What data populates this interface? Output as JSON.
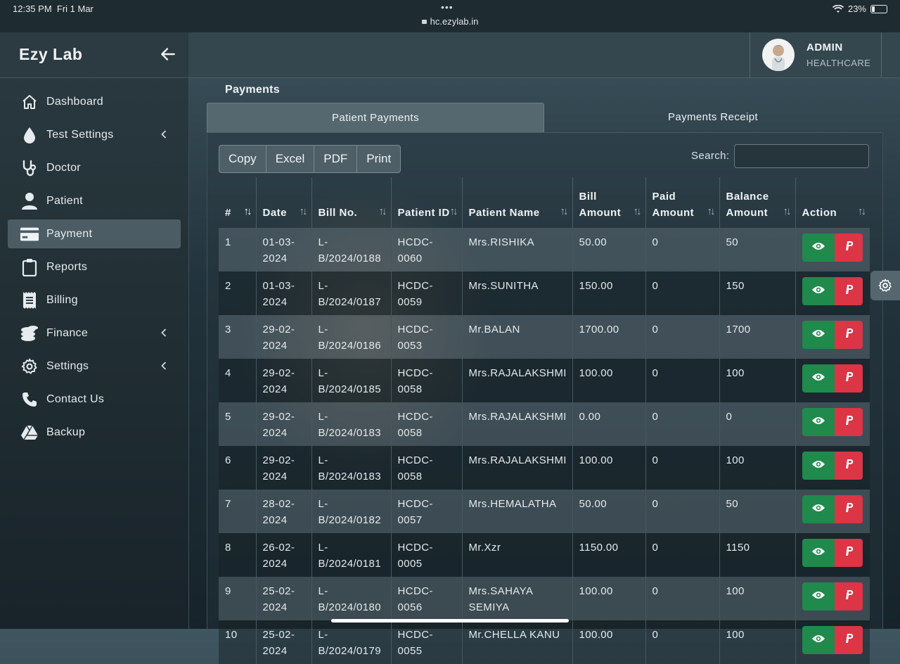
{
  "status_bar": {
    "time": "12:35 PM",
    "date": "Fri 1 Mar",
    "dots": "•••",
    "url": "hc.ezylab.in",
    "battery": "23%"
  },
  "sidebar": {
    "brand": "Ezy Lab",
    "items": [
      {
        "label": "Dashboard",
        "icon": "home-icon",
        "chevron": false,
        "active": false
      },
      {
        "label": "Test Settings",
        "icon": "drop-icon",
        "chevron": true,
        "active": false
      },
      {
        "label": "Doctor",
        "icon": "stethoscope-icon",
        "chevron": false,
        "active": false
      },
      {
        "label": "Patient",
        "icon": "user-icon",
        "chevron": false,
        "active": false
      },
      {
        "label": "Payment",
        "icon": "credit-card-icon",
        "chevron": false,
        "active": true
      },
      {
        "label": "Reports",
        "icon": "clipboard-icon",
        "chevron": false,
        "active": false
      },
      {
        "label": "Billing",
        "icon": "receipt-icon",
        "chevron": false,
        "active": false
      },
      {
        "label": "Finance",
        "icon": "coins-icon",
        "chevron": true,
        "active": false
      },
      {
        "label": "Settings",
        "icon": "gear-icon",
        "chevron": true,
        "active": false
      },
      {
        "label": "Contact Us",
        "icon": "phone-icon",
        "chevron": false,
        "active": false
      },
      {
        "label": "Backup",
        "icon": "drive-icon",
        "chevron": false,
        "active": false
      }
    ]
  },
  "header": {
    "user_name": "ADMIN",
    "user_org": "HEALTHCARE"
  },
  "page": {
    "title": "Payments",
    "tabs": [
      {
        "label": "Patient Payments",
        "active": true
      },
      {
        "label": "Payments Receipt",
        "active": false
      }
    ],
    "export_buttons": [
      "Copy",
      "Excel",
      "PDF",
      "Print"
    ],
    "search_label": "Search:",
    "search_value": ""
  },
  "table": {
    "columns": [
      "#",
      "Date",
      "Bill No.",
      "Patient ID",
      "Patient Name",
      "Bill Amount",
      "Paid Amount",
      "Balance Amount",
      "Action"
    ],
    "rows": [
      {
        "no": "1",
        "date": "01-03-2024",
        "bill": "L-B/2024/0188",
        "pid": "HCDC-0060",
        "name": "Mrs.RISHIKA",
        "bill_amt": "50.00",
        "paid": "0",
        "balance": "50"
      },
      {
        "no": "2",
        "date": "01-03-2024",
        "bill": "L-B/2024/0187",
        "pid": "HCDC-0059",
        "name": "Mrs.SUNITHA",
        "bill_amt": "150.00",
        "paid": "0",
        "balance": "150"
      },
      {
        "no": "3",
        "date": "29-02-2024",
        "bill": "L-B/2024/0186",
        "pid": "HCDC-0053",
        "name": "Mr.BALAN",
        "bill_amt": "1700.00",
        "paid": "0",
        "balance": "1700"
      },
      {
        "no": "4",
        "date": "29-02-2024",
        "bill": "L-B/2024/0185",
        "pid": "HCDC-0058",
        "name": "Mrs.RAJALAKSHMI",
        "bill_amt": "100.00",
        "paid": "0",
        "balance": "100"
      },
      {
        "no": "5",
        "date": "29-02-2024",
        "bill": "L-B/2024/0183",
        "pid": "HCDC-0058",
        "name": "Mrs.RAJALAKSHMI",
        "bill_amt": "0.00",
        "paid": "0",
        "balance": "0"
      },
      {
        "no": "6",
        "date": "29-02-2024",
        "bill": "L-B/2024/0183",
        "pid": "HCDC-0058",
        "name": "Mrs.RAJALAKSHMI",
        "bill_amt": "100.00",
        "paid": "0",
        "balance": "100"
      },
      {
        "no": "7",
        "date": "28-02-2024",
        "bill": "L-B/2024/0182",
        "pid": "HCDC-0057",
        "name": "Mrs.HEMALATHA",
        "bill_amt": "50.00",
        "paid": "0",
        "balance": "50"
      },
      {
        "no": "8",
        "date": "26-02-2024",
        "bill": "L-B/2024/0181",
        "pid": "HCDC-0005",
        "name": "Mr.Xzr",
        "bill_amt": "1150.00",
        "paid": "0",
        "balance": "1150"
      },
      {
        "no": "9",
        "date": "25-02-2024",
        "bill": "L-B/2024/0180",
        "pid": "HCDC-0056",
        "name": "Mrs.SAHAYA SEMIYA",
        "bill_amt": "100.00",
        "paid": "0",
        "balance": "100"
      },
      {
        "no": "10",
        "date": "25-02-2024",
        "bill": "L-B/2024/0179",
        "pid": "HCDC-0055",
        "name": "Mr.CHELLA KANU",
        "bill_amt": "100.00",
        "paid": "0",
        "balance": "100"
      }
    ]
  },
  "colors": {
    "view_button": "#1f8a4c",
    "pay_button": "#dc3545",
    "active_nav": "#4c5c64"
  }
}
